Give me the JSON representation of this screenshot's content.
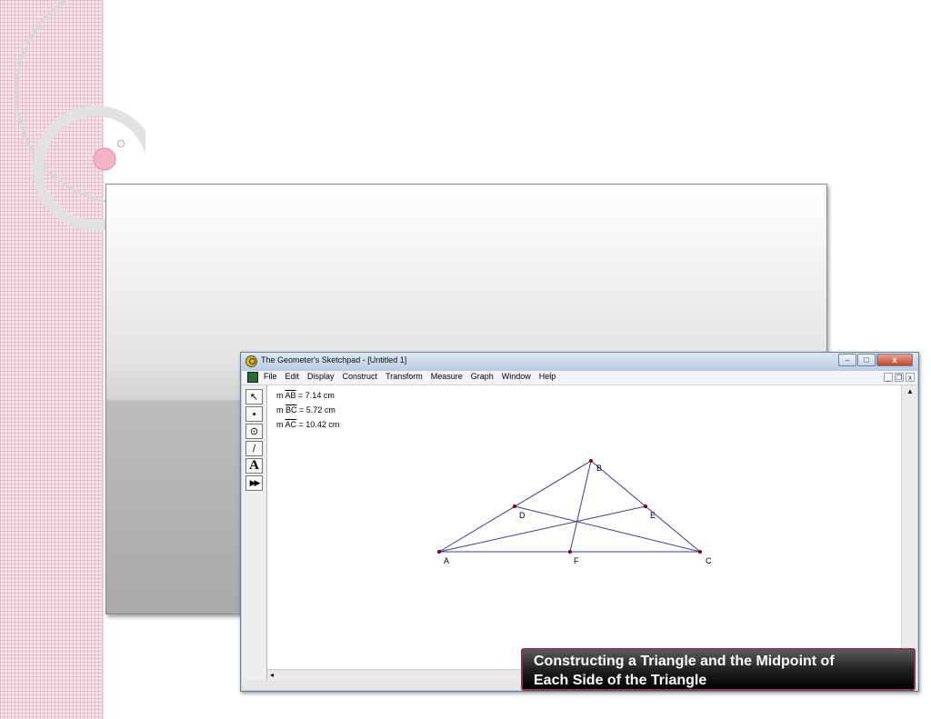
{
  "window": {
    "title": "The Geometer's Sketchpad - [Untitled 1]",
    "controls": {
      "minimize": "–",
      "maximize": "□",
      "close": "x"
    }
  },
  "menu": {
    "items": [
      "File",
      "Edit",
      "Display",
      "Construct",
      "Transform",
      "Measure",
      "Graph",
      "Window",
      "Help"
    ],
    "mdi_controls": {
      "minimize": "_",
      "restore": "❐",
      "close": "x"
    }
  },
  "toolbox": {
    "tools": [
      {
        "name": "arrow-tool",
        "glyph": "↖"
      },
      {
        "name": "point-tool",
        "glyph": "•"
      },
      {
        "name": "compass-tool",
        "glyph": "⊙"
      },
      {
        "name": "straightedge-tool",
        "glyph": "/"
      },
      {
        "name": "text-tool",
        "glyph": "A"
      },
      {
        "name": "custom-tool",
        "glyph": "▶▶"
      }
    ]
  },
  "measurements": [
    {
      "prefix": "m",
      "segment": "AB",
      "value": "= 7.14 cm"
    },
    {
      "prefix": "m",
      "segment": "BC",
      "value": "= 5.72 cm"
    },
    {
      "prefix": "m",
      "segment": "AC",
      "value": "= 10.42 cm"
    }
  ],
  "points": {
    "A": {
      "label": "A"
    },
    "B": {
      "label": "B"
    },
    "C": {
      "label": "C"
    },
    "D": {
      "label": "D"
    },
    "E": {
      "label": "E"
    },
    "F": {
      "label": "F"
    }
  },
  "colors": {
    "segment": "#3c3c9c",
    "point": "#8b0000",
    "caption_border": "#8b3557"
  },
  "caption": {
    "line1": "Constructing a Triangle and the Midpoint of",
    "line2": "Each Side of the Triangle"
  }
}
